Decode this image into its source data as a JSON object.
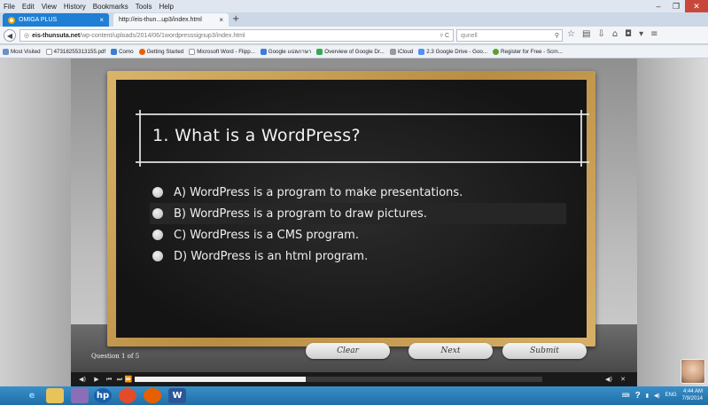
{
  "menu": [
    "File",
    "Edit",
    "View",
    "History",
    "Bookmarks",
    "Tools",
    "Help"
  ],
  "tabs": [
    {
      "label": "OMIGA PLUS"
    },
    {
      "label": "http://eis-thun...up3/index.html"
    }
  ],
  "nav": {
    "url_domain": "eis-thunsuta.net",
    "url_path": "/wp-content/uploads/2014/06/1wordpresssignup3/index.html",
    "search_placeholder": "qunell"
  },
  "bookmarks": [
    {
      "label": "Most Visited",
      "color": "#6b8fc7"
    },
    {
      "label": "473182553131​55.pdf",
      "color": "#ffffff"
    },
    {
      "label": "Como",
      "color": "#3a7bd5"
    },
    {
      "label": "Getting Started",
      "color": "#e66000"
    },
    {
      "label": "Microsoft Word - Flipp...",
      "color": "#ffffff"
    },
    {
      "label": "Google แปลภาษา",
      "color": "#3b7ddd"
    },
    {
      "label": "Overview of Google Dr...",
      "color": "#34a853"
    },
    {
      "label": "iCloud",
      "color": "#999999"
    },
    {
      "label": "2.3 Google Drive - Goo...",
      "color": "#4d90fe"
    },
    {
      "label": "Register for Free - Scrn...",
      "color": "#5aa02c"
    }
  ],
  "quiz": {
    "question": "1. What is a WordPress?",
    "answers": [
      {
        "text": "A) WordPress is a program to make presentations."
      },
      {
        "text": "B) WordPress is a program to draw pictures."
      },
      {
        "text": "C) WordPress is a CMS program."
      },
      {
        "text": "D) WordPress is an html program."
      }
    ],
    "question_count": "Question 1 of 5",
    "buttons": {
      "clear": "Clear",
      "next": "Next",
      "submit": "Submit"
    }
  },
  "player": {
    "progress": 0.42
  },
  "taskbar": {
    "lang": "ENG",
    "time": "4:44 AM",
    "date": "7/9/2014"
  }
}
